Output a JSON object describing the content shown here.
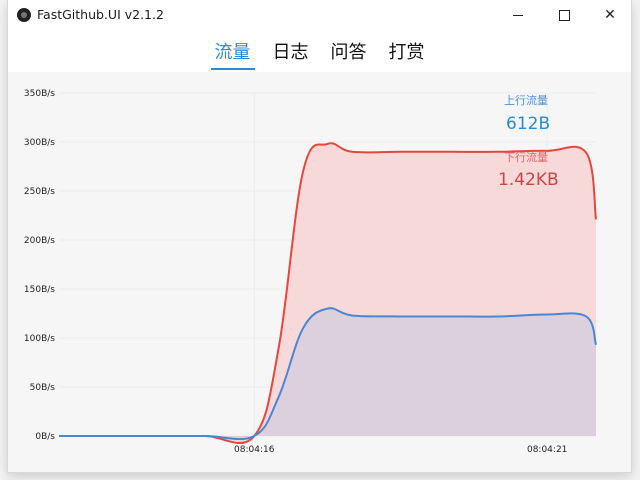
{
  "window": {
    "title": "FastGithub.UI v2.1.2"
  },
  "tabs": [
    {
      "label": "流量",
      "active": true
    },
    {
      "label": "日志",
      "active": false
    },
    {
      "label": "问答",
      "active": false
    },
    {
      "label": "打赏",
      "active": false
    }
  ],
  "legend": {
    "upload_label": "上行流量",
    "upload_value": "612B",
    "download_label": "下行流量",
    "download_value": "1.42KB"
  },
  "colors": {
    "accent": "#2b8ad8",
    "upload_line": "#4a86d6",
    "download_line": "#e5473d",
    "download_fill": "#f8d7d7",
    "upload_fill": "#d9d0dc"
  },
  "chart_data": {
    "type": "area",
    "ylabel": "",
    "xlabel": "",
    "ylim": [
      0,
      350
    ],
    "y_ticks": [
      "0B/s",
      "50B/s",
      "100B/s",
      "150B/s",
      "200B/s",
      "250B/s",
      "300B/s",
      "350B/s"
    ],
    "x_ticks": [
      "08:04:16",
      "08:04:21"
    ],
    "x": [
      0,
      1,
      2,
      3,
      4,
      4.5,
      5,
      5.5,
      6,
      7,
      8,
      9,
      10,
      10.8,
      11
    ],
    "series": [
      {
        "name": "上行流量",
        "values": [
          0,
          0,
          0,
          0,
          0,
          40,
          110,
          130,
          123,
          122,
          122,
          122,
          124,
          122,
          93
        ]
      },
      {
        "name": "下行流量",
        "values": [
          0,
          0,
          0,
          0,
          0,
          90,
          270,
          298,
          290,
          290,
          290,
          290,
          291,
          289,
          221
        ]
      }
    ]
  }
}
